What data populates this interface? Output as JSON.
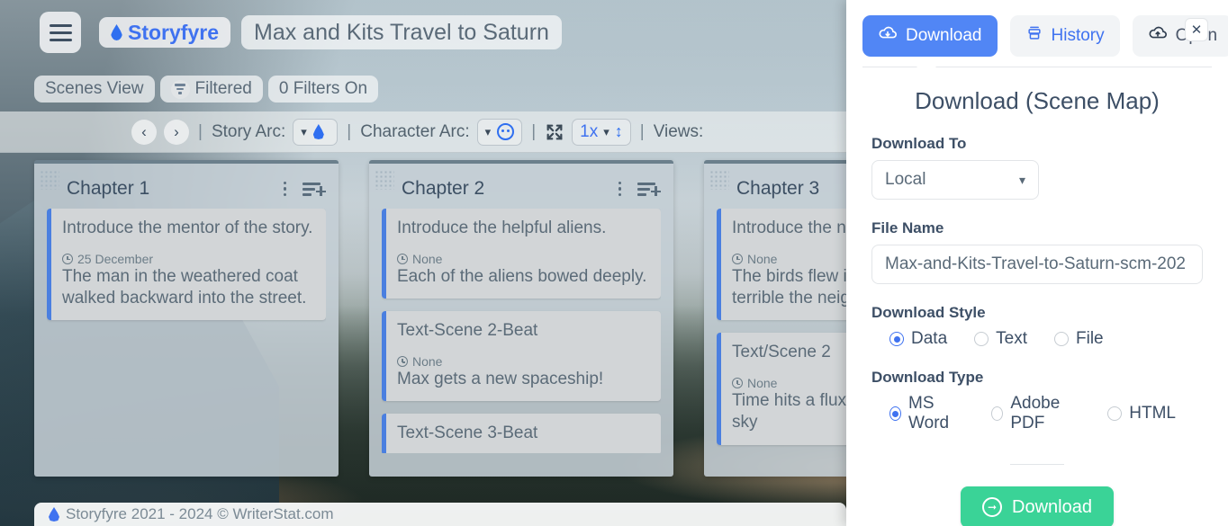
{
  "app": {
    "brand": "Storyfyre",
    "story_title": "Max and Kits Travel to Saturn",
    "menu_icon": "hamburger-icon",
    "brand_icon": "flame-icon"
  },
  "chips": [
    {
      "label": "Scenes View",
      "icon": null
    },
    {
      "label": "Filtered",
      "icon": "filter-icon"
    },
    {
      "label": "0 Filters On",
      "icon": null
    }
  ],
  "toolbar": {
    "prev": "‹",
    "next": "›",
    "separator": "|",
    "story_arc_label": "Story Arc:",
    "story_arc_value": "",
    "story_arc_icon": "flame-icon",
    "character_arc_label": "Character Arc:",
    "character_arc_value": "",
    "character_arc_icon": "face-icon",
    "expand_icon": "expand-arrows-icon",
    "zoom_level": "1x",
    "zoom_updown_icon": "up-down-arrow-icon",
    "views_label": "Views:"
  },
  "board": {
    "columns": [
      {
        "title": "Chapter 1",
        "cards": [
          {
            "title": "Introduce the mentor of the story.",
            "meta": "25 December",
            "body": "The man in the weathered coat walked backward into the street."
          }
        ]
      },
      {
        "title": "Chapter 2",
        "cards": [
          {
            "title": "Introduce the helpful aliens.",
            "meta": "None",
            "body": "Each of the aliens bowed deeply."
          },
          {
            "title": "Text-Scene 2-Beat",
            "meta": "None",
            "body": "Max gets a new spaceship!"
          },
          {
            "title": "Text-Scene 3-Beat",
            "meta": "",
            "body": ""
          }
        ]
      },
      {
        "title": "Chapter 3",
        "cards": [
          {
            "title": "Introduce the ne",
            "meta": "None",
            "body": "The birds flew in making a terrible the neighbors."
          },
          {
            "title": "Text/Scene 2",
            "meta": "None",
            "body": "Time hits a flux. their true colors sky"
          }
        ]
      }
    ]
  },
  "footer": {
    "text": "Storyfyre 2021 - 2024 ©  WriterStat.com",
    "icon": "flame-icon"
  },
  "panel": {
    "tabs": [
      {
        "label": "Download",
        "icon": "cloud-download-icon",
        "active": true
      },
      {
        "label": "History",
        "icon": "history-icon",
        "active": false
      },
      {
        "label": "Open",
        "icon": "cloud-upload-icon",
        "active": false
      }
    ],
    "close_icon": "close-icon",
    "heading": "Download (Scene Map)",
    "download_to": {
      "label": "Download To",
      "value": "Local",
      "chevron_icon": "chevron-down-icon"
    },
    "file_name": {
      "label": "File Name",
      "value": "Max-and-Kits-Travel-to-Saturn-scm-202"
    },
    "download_style": {
      "label": "Download Style",
      "options": [
        {
          "label": "Data",
          "selected": true
        },
        {
          "label": "Text",
          "selected": false
        },
        {
          "label": "File",
          "selected": false
        }
      ]
    },
    "download_type": {
      "label": "Download Type",
      "options": [
        {
          "label": "MS Word",
          "selected": true
        },
        {
          "label": "Adobe PDF",
          "selected": false
        },
        {
          "label": "HTML",
          "selected": false
        }
      ]
    },
    "submit": {
      "label": "Download",
      "icon": "arrow-circle-right-icon",
      "color": "#3ad397"
    }
  },
  "colors": {
    "accent_blue": "#3f72f0",
    "tab_active": "#5186f5",
    "card_accent": "#4a7fe0",
    "green": "#3ad397",
    "text_dark": "#3d4f66",
    "text_muted": "#5a6a78"
  }
}
